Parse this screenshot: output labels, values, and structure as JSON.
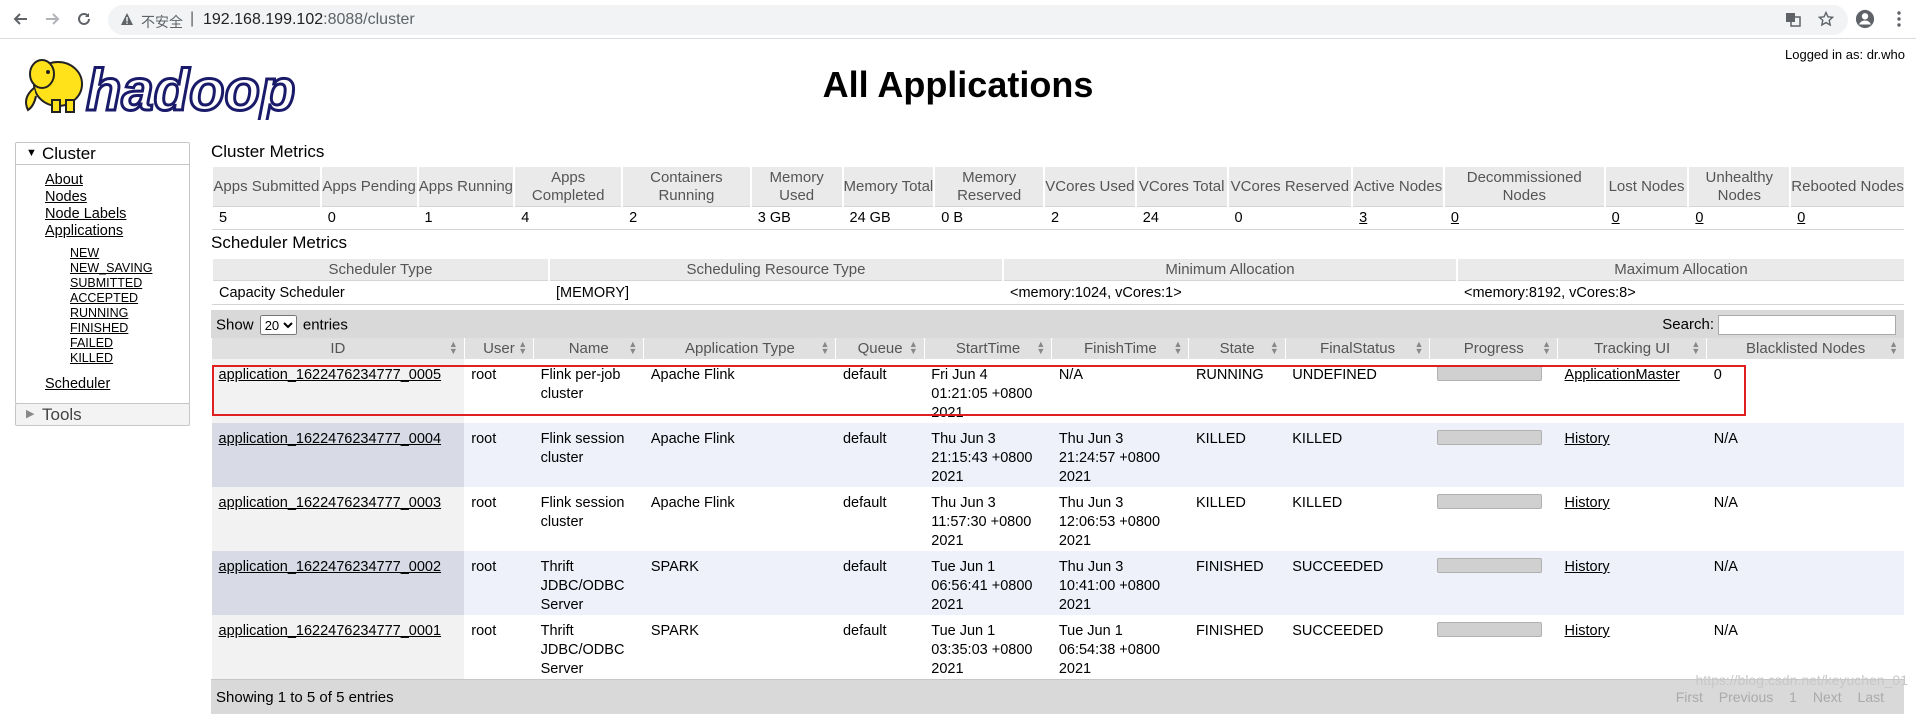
{
  "browser": {
    "insecure_label": "不安全",
    "url_host": "192.168.199.102",
    "url_rest": ":8088/cluster"
  },
  "header": {
    "logo_text": "hadoop",
    "title": "All Applications",
    "logged_in": "Logged in as: dr.who"
  },
  "sidebar": {
    "cluster_label": "Cluster",
    "links": [
      "About",
      "Nodes",
      "Node Labels",
      "Applications"
    ],
    "states": [
      "NEW",
      "NEW_SAVING",
      "SUBMITTED",
      "ACCEPTED",
      "RUNNING",
      "FINISHED",
      "FAILED",
      "KILLED"
    ],
    "scheduler": "Scheduler",
    "tools_label": "Tools"
  },
  "cluster_metrics": {
    "title": "Cluster Metrics",
    "headers": [
      "Apps Submitted",
      "Apps Pending",
      "Apps Running",
      "Apps Completed",
      "Containers Running",
      "Memory Used",
      "Memory Total",
      "Memory Reserved",
      "VCores Used",
      "VCores Total",
      "VCores Reserved",
      "Active Nodes",
      "Decommissioned Nodes",
      "Lost Nodes",
      "Unhealthy Nodes",
      "Rebooted Nodes"
    ],
    "values": [
      "5",
      "0",
      "1",
      "4",
      "2",
      "3 GB",
      "24 GB",
      "0 B",
      "2",
      "24",
      "0",
      "3",
      "0",
      "0",
      "0",
      "0"
    ]
  },
  "scheduler_metrics": {
    "title": "Scheduler Metrics",
    "headers": [
      "Scheduler Type",
      "Scheduling Resource Type",
      "Minimum Allocation",
      "Maximum Allocation"
    ],
    "values": [
      "Capacity Scheduler",
      "[MEMORY]",
      "<memory:1024, vCores:1>",
      "<memory:8192, vCores:8>"
    ]
  },
  "apps": {
    "show_label": "Show",
    "entries_value": "20",
    "entries_label": "entries",
    "search_label": "Search:",
    "headers": [
      "ID",
      "User",
      "Name",
      "Application Type",
      "Queue",
      "StartTime",
      "FinishTime",
      "State",
      "FinalStatus",
      "Progress",
      "Tracking UI",
      "Blacklisted Nodes"
    ],
    "rows": [
      {
        "id": "application_1622476234777_0005",
        "user": "root",
        "name": "Flink per-job cluster",
        "type": "Apache Flink",
        "queue": "default",
        "start": "Fri Jun 4 01:21:05 +0800 2021",
        "finish": "N/A",
        "state": "RUNNING",
        "final": "UNDEFINED",
        "progress": 0,
        "tracking": "ApplicationMaster",
        "blacklisted": "0"
      },
      {
        "id": "application_1622476234777_0004",
        "user": "root",
        "name": "Flink session cluster",
        "type": "Apache Flink",
        "queue": "default",
        "start": "Thu Jun 3 21:15:43 +0800 2021",
        "finish": "Thu Jun 3 21:24:57 +0800 2021",
        "state": "KILLED",
        "final": "KILLED",
        "progress": 0,
        "tracking": "History",
        "blacklisted": "N/A"
      },
      {
        "id": "application_1622476234777_0003",
        "user": "root",
        "name": "Flink session cluster",
        "type": "Apache Flink",
        "queue": "default",
        "start": "Thu Jun 3 11:57:30 +0800 2021",
        "finish": "Thu Jun 3 12:06:53 +0800 2021",
        "state": "KILLED",
        "final": "KILLED",
        "progress": 0,
        "tracking": "History",
        "blacklisted": "N/A"
      },
      {
        "id": "application_1622476234777_0002",
        "user": "root",
        "name": "Thrift JDBC/ODBC Server",
        "type": "SPARK",
        "queue": "default",
        "start": "Tue Jun 1 06:56:41 +0800 2021",
        "finish": "Thu Jun 3 10:41:00 +0800 2021",
        "state": "FINISHED",
        "final": "SUCCEEDED",
        "progress": 0,
        "tracking": "History",
        "blacklisted": "N/A"
      },
      {
        "id": "application_1622476234777_0001",
        "user": "root",
        "name": "Thrift JDBC/ODBC Server",
        "type": "SPARK",
        "queue": "default",
        "start": "Tue Jun 1 03:35:03 +0800 2021",
        "finish": "Tue Jun 1 06:54:38 +0800 2021",
        "state": "FINISHED",
        "final": "SUCCEEDED",
        "progress": 0,
        "tracking": "History",
        "blacklisted": "N/A"
      }
    ],
    "footer_info": "Showing 1 to 5 of 5 entries",
    "pagination": [
      "First",
      "Previous",
      "1",
      "Next",
      "Last"
    ]
  },
  "watermark": "https://blog.csdn.net/keyuchen_01"
}
